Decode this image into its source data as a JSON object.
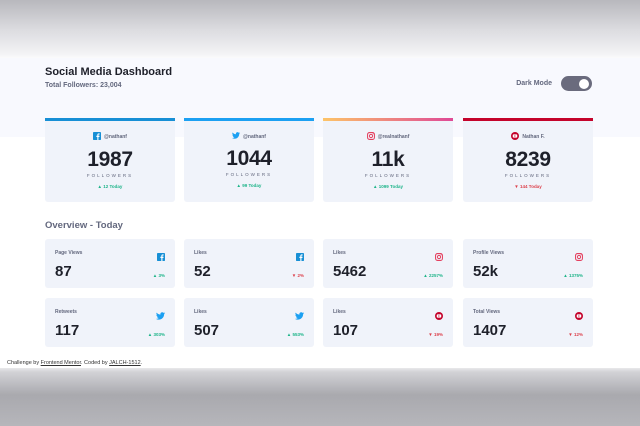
{
  "header": {
    "title": "Social Media Dashboard",
    "total_followers": "Total Followers: 23,004",
    "dark_mode_label": "Dark Mode"
  },
  "colors": {
    "facebook": "#178fd5",
    "twitter": "#1ca0f2",
    "instagram_gradient": [
      "#fdc468",
      "#df4996"
    ],
    "youtube": "#c4032b",
    "up": "#1db489",
    "down": "#dc414c"
  },
  "cards": [
    {
      "platform": "facebook",
      "icon": "facebook-icon",
      "handle": "@nathanf",
      "count": "1987",
      "unit": "FOLLOWERS",
      "delta": "12 Today",
      "trend": "up"
    },
    {
      "platform": "twitter",
      "icon": "twitter-icon",
      "handle": "@nathanf",
      "count": "1044",
      "unit": "FOLLOWERS",
      "delta": "99 Today",
      "trend": "up"
    },
    {
      "platform": "instagram",
      "icon": "instagram-icon",
      "handle": "@realnathanf",
      "count": "11k",
      "unit": "FOLLOWERS",
      "delta": "1099 Today",
      "trend": "up"
    },
    {
      "platform": "youtube",
      "icon": "youtube-icon",
      "handle": "Nathan F.",
      "count": "8239",
      "unit": "FOLLOWERS",
      "delta": "144 Today",
      "trend": "down"
    }
  ],
  "overview": {
    "title": "Overview - Today",
    "tiles": [
      {
        "label": "Page Views",
        "icon": "facebook-icon",
        "value": "87",
        "delta": "3%",
        "trend": "up"
      },
      {
        "label": "Likes",
        "icon": "facebook-icon",
        "value": "52",
        "delta": "2%",
        "trend": "down"
      },
      {
        "label": "Likes",
        "icon": "instagram-icon",
        "value": "5462",
        "delta": "2257%",
        "trend": "up"
      },
      {
        "label": "Profile Views",
        "icon": "instagram-icon",
        "value": "52k",
        "delta": "1375%",
        "trend": "up"
      },
      {
        "label": "Retweets",
        "icon": "twitter-icon",
        "value": "117",
        "delta": "303%",
        "trend": "up"
      },
      {
        "label": "Likes",
        "icon": "twitter-icon",
        "value": "507",
        "delta": "553%",
        "trend": "up"
      },
      {
        "label": "Likes",
        "icon": "youtube-icon",
        "value": "107",
        "delta": "19%",
        "trend": "down"
      },
      {
        "label": "Total Views",
        "icon": "youtube-icon",
        "value": "1407",
        "delta": "12%",
        "trend": "down"
      }
    ]
  },
  "footer": {
    "prefix": "Challenge by ",
    "link1": "Frontend Mentor",
    "middle": ". Coded by ",
    "link2": "JALCH-1512",
    "suffix": "."
  }
}
